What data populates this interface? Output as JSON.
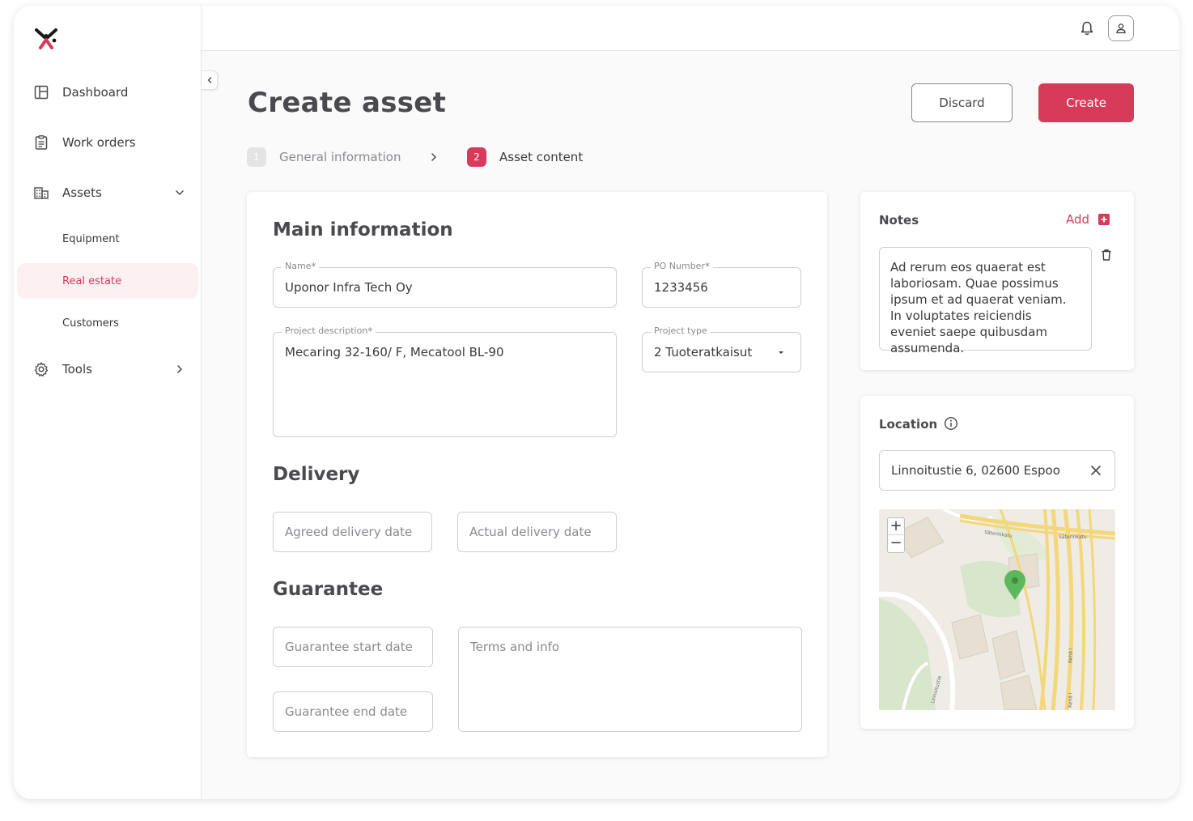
{
  "sidebar": {
    "items": [
      {
        "label": "Dashboard",
        "icon": "dashboard-icon"
      },
      {
        "label": "Work orders",
        "icon": "clipboard-icon"
      },
      {
        "label": "Assets",
        "icon": "building-icon"
      },
      {
        "label": "Tools",
        "icon": "gear-icon"
      }
    ],
    "subitems": [
      {
        "label": "Equipment"
      },
      {
        "label": "Real estate"
      },
      {
        "label": "Customers"
      }
    ],
    "active_subitem": "Real estate"
  },
  "header": {
    "title": "Create asset",
    "discard_label": "Discard",
    "create_label": "Create"
  },
  "stepper": {
    "steps": [
      {
        "number": "1",
        "label": "General information",
        "state": "inactive"
      },
      {
        "number": "2",
        "label": "Asset content",
        "state": "active"
      }
    ]
  },
  "main_information": {
    "title": "Main information",
    "name": {
      "label": "Name",
      "required": "*",
      "value": "Uponor Infra Tech Oy"
    },
    "po_number": {
      "label": "PO Number",
      "required": "*",
      "value": "1233456"
    },
    "project_description": {
      "label": "Project description",
      "required": "*",
      "value": "Mecaring 32-160/ F, Mecatool BL-90"
    },
    "project_type": {
      "label": "Project type",
      "value": "2 Tuoteratkaisut"
    }
  },
  "delivery": {
    "title": "Delivery",
    "agreed_placeholder": "Agreed delivery date",
    "actual_placeholder": "Actual delivery date"
  },
  "guarantee": {
    "title": "Guarantee",
    "start_placeholder": "Guarantee start date",
    "end_placeholder": "Guarantee end date",
    "terms_placeholder": "Terms and info"
  },
  "notes": {
    "title": "Notes",
    "add_label": "Add",
    "note_text": "Ad rerum eos quaerat est laboriosam. Quae possimus ipsum et ad quaerat veniam. In voluptates reiciendis eveniet saepe quibusdam assumenda."
  },
  "location": {
    "title": "Location",
    "address": "Linnoitustie 6, 02600 Espoo",
    "map": {
      "zoom_in": "+",
      "zoom_out": "−",
      "street_labels": [
        "Säterinkatu",
        "Säterinkatu",
        "Kehä I",
        "Kehä I",
        "Linnoitustie"
      ]
    }
  },
  "colors": {
    "accent": "#d83b5a",
    "pin": "#5cb85c"
  }
}
